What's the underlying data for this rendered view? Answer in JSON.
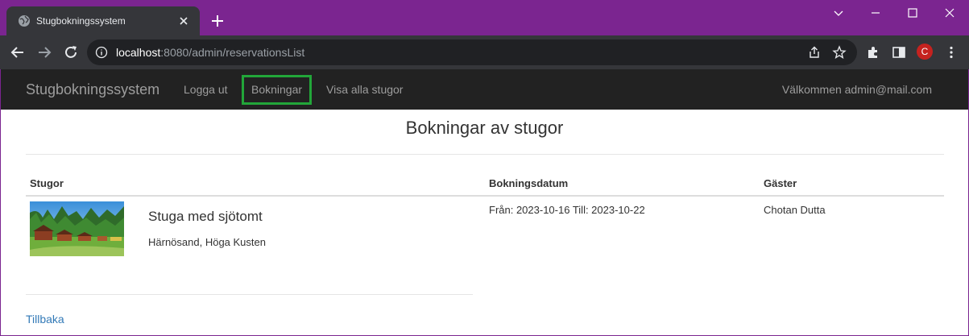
{
  "browser": {
    "tab_title": "Stugbokningssystem",
    "url_host": "localhost",
    "url_rest": ":8080/admin/reservationsList",
    "profile_initial": "C",
    "icons": [
      "globe-icon",
      "close-icon",
      "plus-icon",
      "minimize-icon",
      "maximize-icon",
      "chevron-down-icon",
      "back-arrow-icon",
      "forward-arrow-icon",
      "reload-icon",
      "info-icon",
      "share-icon",
      "star-icon",
      "puzzle-icon",
      "sidepanel-icon",
      "kebab-menu-icon"
    ]
  },
  "navbar": {
    "brand": "Stugbokningssystem",
    "links": [
      "Logga ut",
      "Bokningar",
      "Visa alla stugor"
    ],
    "welcome": "Välkommen admin@mail.com",
    "highlight_color": "#22a639"
  },
  "main": {
    "heading": "Bokningar av stugor",
    "columns": [
      "Stugor",
      "Bokningsdatum",
      "Gäster"
    ],
    "rows": [
      {
        "name": "Stuga med sjötomt",
        "location": "Härnösand, Höga Kusten",
        "dates": "Från: 2023-10-16 Till: 2023-10-22",
        "guest": "Chotan Dutta"
      }
    ],
    "back_link": "Tillbaka"
  },
  "colors": {
    "window_frame": "#7b2590",
    "navbar_bg": "#222222",
    "link": "#337ab7"
  }
}
